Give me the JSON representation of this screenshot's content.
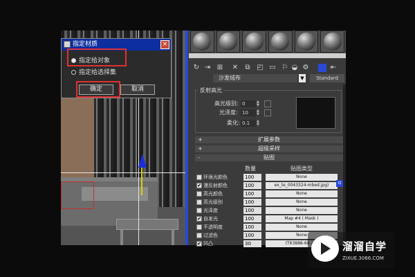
{
  "dialog": {
    "title": "指定材质",
    "close": "×",
    "options": [
      {
        "label": "指定给对象",
        "selected": true
      },
      {
        "label": "指定给选择集",
        "selected": false
      }
    ],
    "ok_label": "确定",
    "cancel_label": "取消"
  },
  "material_editor": {
    "name": "沙发绒布",
    "type_button": "Standard",
    "specular_group": {
      "title": "反射高光",
      "level_label": "高光级别:",
      "level_value": "0",
      "gloss_label": "光泽度:",
      "gloss_value": "10",
      "soften_label": "柔化:",
      "soften_value": "0.1"
    },
    "rollouts": [
      {
        "sign": "+",
        "label": "扩展参数"
      },
      {
        "sign": "+",
        "label": "超级采样"
      },
      {
        "sign": "-",
        "label": "贴图"
      }
    ],
    "maps": {
      "amount_header": "数量",
      "type_header": "贴图类型",
      "rows": [
        {
          "name": "环境光颜色",
          "checked": false,
          "amount": "100",
          "map": "None"
        },
        {
          "name": "漫反射颜色",
          "checked": true,
          "amount": "100",
          "map": "ex_te_0043324-mbed.jpg)"
        },
        {
          "name": "高光颜色",
          "checked": false,
          "amount": "100",
          "map": "None"
        },
        {
          "name": "高光级别",
          "checked": false,
          "amount": "100",
          "map": "None"
        },
        {
          "name": "光泽度",
          "checked": false,
          "amount": "100",
          "map": "None"
        },
        {
          "name": "自发光",
          "checked": true,
          "amount": "100",
          "map": "Map #4  ( Mask )"
        },
        {
          "name": "不透明度",
          "checked": false,
          "amount": "100",
          "map": "None"
        },
        {
          "name": "过滤色",
          "checked": false,
          "amount": "100",
          "map": "None"
        },
        {
          "name": "凹凸",
          "checked": true,
          "amount": "30",
          "map": "(T63888-68-2-e"
        }
      ]
    }
  },
  "watermark": {
    "brand": "溜溜自学",
    "url": "ZIXUE.3066.COM"
  },
  "colors": {
    "dialog_title_bar": "#0c2e9e",
    "highlight": "#e03030",
    "viewport_border": "#2a49d8"
  }
}
